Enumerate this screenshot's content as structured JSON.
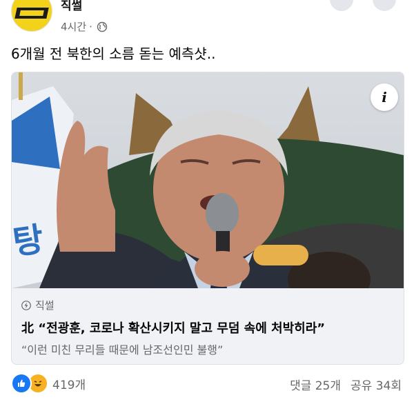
{
  "post": {
    "author": "직썰",
    "time": "4시간",
    "separator": "·",
    "text": "6개월 전 북한의 소름 돋는 예측샷.."
  },
  "link_card": {
    "source": "직썰",
    "headline": "北 “전광훈, 코로나 확산시키지 말고 무덤 속에 처박히라”",
    "subline": "“이런 미친 무리들 때문에 남조선인민 불행”",
    "info_label": "i"
  },
  "footer": {
    "reaction_count": "419개",
    "comments": "댓글 25개",
    "shares": "공유 34회"
  },
  "colors": {
    "like": "#1877f2",
    "haha": "#f7b125",
    "secondary_text": "#65676b",
    "card_bg": "#f0f2f5"
  },
  "icons": [
    "globe-icon",
    "info-icon",
    "bolt-icon",
    "like-icon",
    "haha-icon"
  ]
}
